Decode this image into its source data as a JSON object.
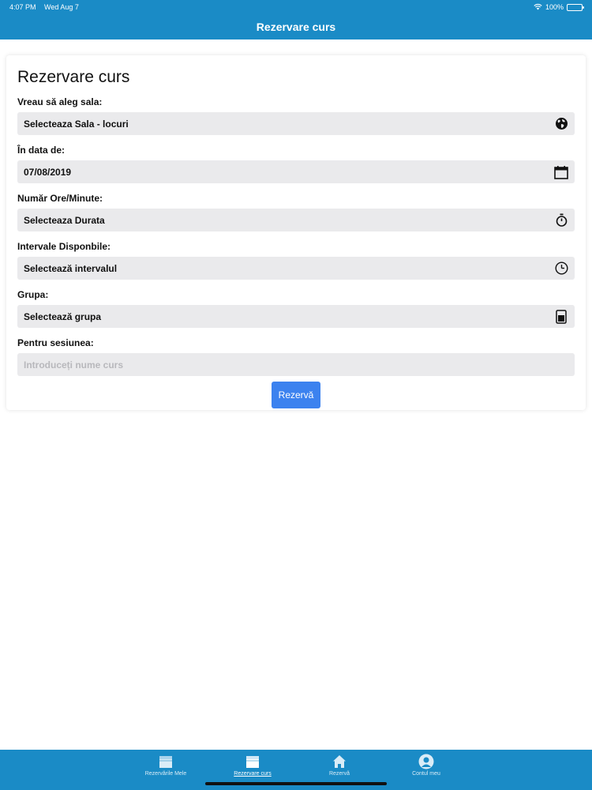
{
  "status_bar": {
    "time": "4:07 PM",
    "date": "Wed Aug 7",
    "battery": "100%",
    "battery_level": 1.0
  },
  "nav": {
    "title": "Rezervare curs"
  },
  "form": {
    "title": "Rezervare curs",
    "fields": [
      {
        "label": "Vreau să aleg sala:",
        "value": "Selecteaza Sala - locuri",
        "icon": "globe-icon"
      },
      {
        "label": "În data de:",
        "value": "07/08/2019",
        "icon": "calendar-icon"
      },
      {
        "label": "Număr Ore/Minute:",
        "value": "Selecteaza Durata",
        "icon": "stopwatch-icon"
      },
      {
        "label": "Intervale Disponbile:",
        "value": "Selectează intervalul",
        "icon": "clock-icon"
      },
      {
        "label": "Grupa:",
        "value": "Selectează grupa",
        "icon": "group-icon"
      },
      {
        "label": "Pentru sesiunea:",
        "value": "",
        "placeholder": "Introduceți nume curs"
      }
    ],
    "submit_label": "Rezervă"
  },
  "tab_bar": {
    "tabs": [
      {
        "label": "Rezervările Mele",
        "icon": "calendar-icon",
        "active": false
      },
      {
        "label": "Rezervare curs",
        "icon": "calendar-icon",
        "active": true
      },
      {
        "label": "Rezervă",
        "icon": "home-icon",
        "active": false
      },
      {
        "label": "Contul meu",
        "icon": "user-icon",
        "active": false
      }
    ]
  },
  "colors": {
    "primary": "#1a8bc6",
    "button": "#3c82ef",
    "field_bg": "#eaeaec"
  }
}
